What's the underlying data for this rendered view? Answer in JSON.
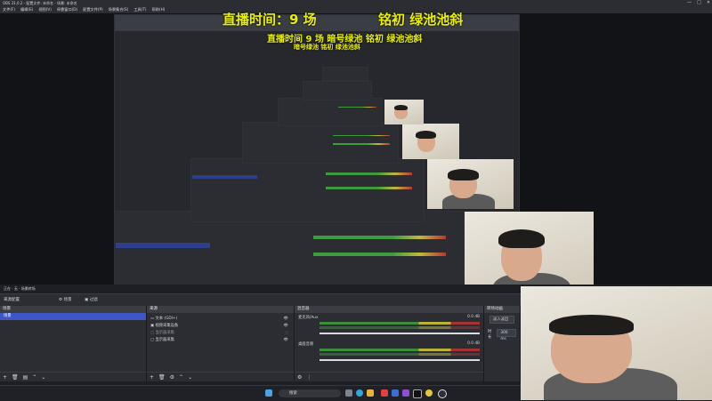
{
  "window": {
    "title": "OBS 31.0.2 - 配置文件: 未命名 - 场景: 未命名",
    "controls": [
      "—",
      "□",
      "✕"
    ]
  },
  "menu": [
    "文件(F)",
    "编辑(E)",
    "视图(V)",
    "停靠窗口(D)",
    "配置文件(P)",
    "场景集合(S)",
    "工具(T)",
    "帮助(H)"
  ],
  "overlay": {
    "line1_left": "直播时间：9 场",
    "line1_right": "铭初 绿池池斜",
    "line2": "直播时间 9 场 暗号绿池 铭初 绿池池斜",
    "line3": "暗号绿池 铭初 绿池池斜"
  },
  "status": {
    "left": "正在 · 无 · 场景转场"
  },
  "toolbar": {
    "scene_filter": "场景",
    "filters": "过滤",
    "label_left": "来源配置"
  },
  "scenes": {
    "header": "场景",
    "items": [
      "场景"
    ]
  },
  "sources": {
    "header": "来源",
    "items": [
      {
        "name": "文本 (GDI+)",
        "icon": "text-icon"
      },
      {
        "name": "视频采集设备",
        "icon": "camera-icon"
      },
      {
        "name": "显示器采集",
        "icon": "monitor-icon"
      },
      {
        "name": "显示器采集",
        "icon": "monitor-icon"
      }
    ]
  },
  "mixer": {
    "header": "混音器",
    "channels": [
      {
        "name": "麦克风/Aux",
        "db": "0.0 dB"
      },
      {
        "name": "桌面音频",
        "db": "0.0 dB"
      }
    ]
  },
  "transitions": {
    "header": "转场动画",
    "fade": "淡入淡出",
    "duration_label": "时长",
    "duration": "300 ms"
  },
  "taskbar": {
    "search_placeholder": "搜索"
  },
  "colors": {
    "accent": "#3d57c4",
    "meter_green": "#3b8f3b",
    "meter_yellow": "#b8b23a",
    "meter_red": "#a33434",
    "overlay_text": "#e9f000"
  }
}
